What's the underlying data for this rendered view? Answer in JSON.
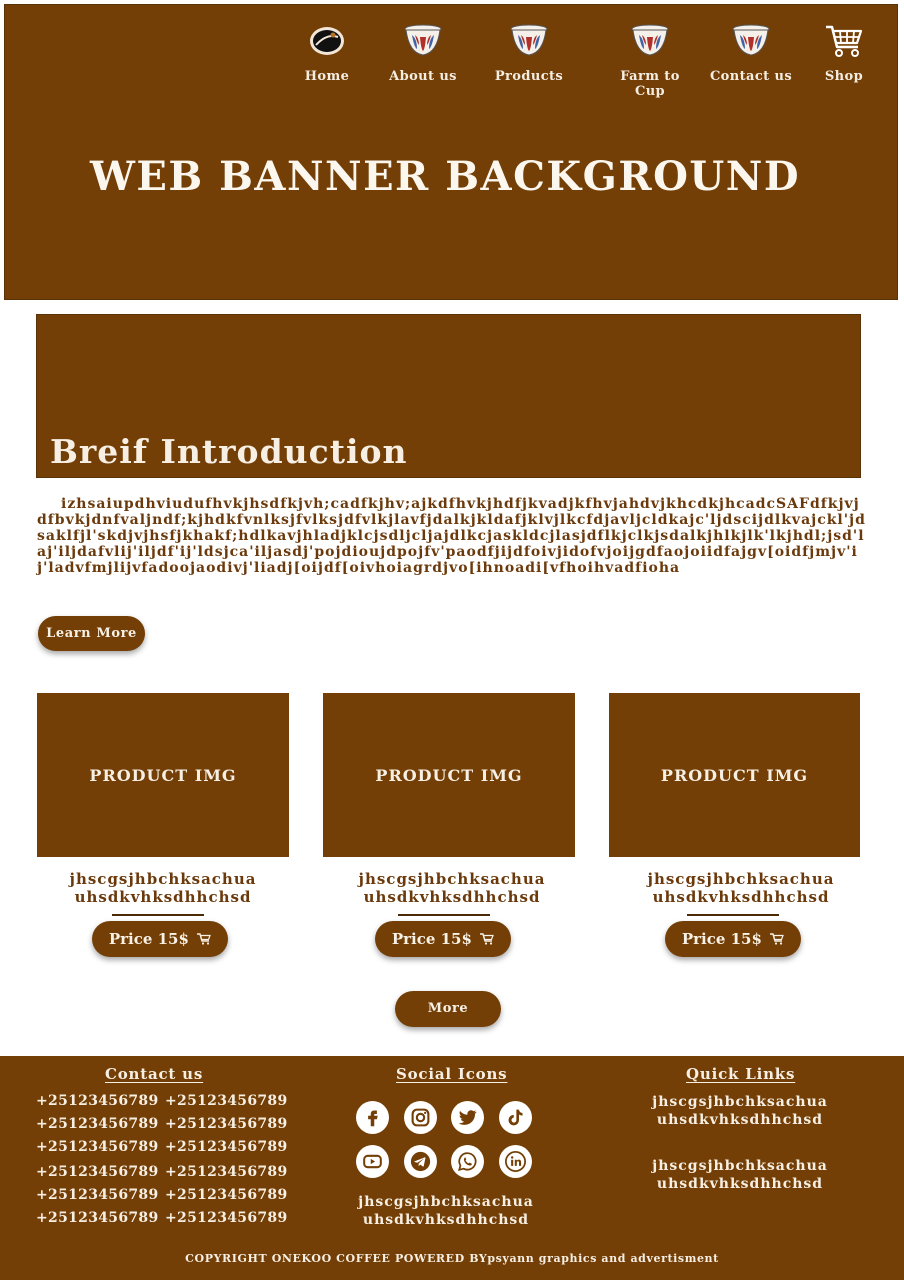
{
  "nav": {
    "items": [
      {
        "label": "Home",
        "icon": "coffee-bean-icon"
      },
      {
        "label": "About us",
        "icon": "coffee-cup-icon"
      },
      {
        "label": "Products",
        "icon": "coffee-cup-icon"
      },
      {
        "label": "Farm to Cup",
        "icon": "coffee-cup-icon"
      },
      {
        "label": "Contact us",
        "icon": "coffee-cup-icon"
      },
      {
        "label": "Shop",
        "icon": "shopping-cart-icon"
      }
    ]
  },
  "banner": {
    "title": "WEB BANNER BACKGROUND"
  },
  "intro": {
    "title": "Breif Introduction",
    "text": "izhsaiupdhviudufhvkjhsdfkjvh;cadfkjhv;ajkdfhvkjhdfjkvadjkfhvjahdvjkhcdkjhcadcSAFdfkjvjdfbvkjdnfvaljndf;kjhdkfvnlksjfvlksjdfvlkjlavfjdalkjkldafjklvjlkcfdjavljcldkajc'ljdscijdlkvajckl'jdsaklfjl'skdjvjhsfjkhakf;hdlkavjhladjklcjsdljcljajdlkcjaskldcjlasjdflkjclkjsdalkjhlkjlk'lkjhdl;jsd'laj'iljdafvlij'iljdf'ij'ldsjca'iljasdj'pojdioujdpojfv'paodfjijdfoivjidofvjoijgdfaojoiidfajgv[oidfjmjv'ij'ladvfmjlijvfadoojaodivj'liadj[oijdf[oivhoiagrdjvo[ihnoadi[vfhoihvadfioha",
    "learn_more": "Learn More"
  },
  "products": [
    {
      "image_label": "PRODUCT IMG",
      "desc_line1": "jhscgsjhbchksachua",
      "desc_line2": "uhsdkvhksdhhchsd",
      "price": "Price  15$"
    },
    {
      "image_label": "PRODUCT IMG",
      "desc_line1": "jhscgsjhbchksachua",
      "desc_line2": "uhsdkvhksdhhchsd",
      "price": "Price  15$"
    },
    {
      "image_label": "PRODUCT IMG",
      "desc_line1": "jhscgsjhbchksachua",
      "desc_line2": "uhsdkvhksdhhchsd",
      "price": "Price  15$"
    }
  ],
  "more_button": "More",
  "footer": {
    "contact_heading": "Contact us",
    "phones": [
      "+25123456789",
      "+25123456789",
      "+25123456789",
      "+25123456789",
      "+25123456789",
      "+25123456789",
      "+25123456789",
      "+25123456789",
      "+25123456789",
      "+25123456789",
      "+25123456789",
      "+25123456789"
    ],
    "social_heading": "Social Icons",
    "social_icons": [
      "facebook-icon",
      "instagram-icon",
      "twitter-icon",
      "tiktok-icon",
      "youtube-icon",
      "telegram-icon",
      "whatsapp-icon",
      "linkedin-icon"
    ],
    "social_text_line1": "jhscgsjhbchksachua",
    "social_text_line2": "uhsdkvhksdhhchsd",
    "links_heading": "Quick Links",
    "quick_links": [
      {
        "line1": "jhscgsjhbchksachua",
        "line2": "uhsdkvhksdhhchsd"
      },
      {
        "line1": "jhscgsjhbchksachua",
        "line2": "uhsdkvhksdhhchsd"
      }
    ],
    "copyright": "COPYRIGHT ONEKOO COFFEE POWERED BYpsyann graphics and advertisment"
  },
  "colors": {
    "brand_brown": "#733f06",
    "text_brown": "#6b3a0c",
    "cream": "#f7efe3"
  }
}
